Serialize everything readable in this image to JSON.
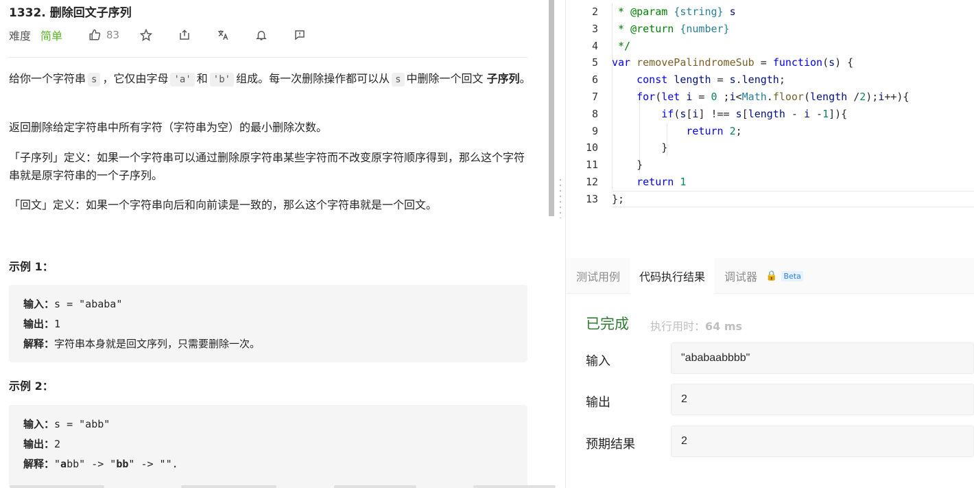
{
  "problem": {
    "title": "1332. 删除回文子序列",
    "difficulty_label": "难度",
    "difficulty": "简单",
    "like_count": "83",
    "desc1_pre": "给你一个字符串",
    "desc1_s": "s",
    "desc1_mid1": "，它仅由字母",
    "desc1_a": "'a'",
    "desc1_and": "和",
    "desc1_b": "'b'",
    "desc1_mid2": "组成。每一次删除操作都可以从",
    "desc1_s2": "s",
    "desc1_mid3": "中删除一个回文",
    "desc1_bold": "子序列",
    "desc1_end": "。",
    "desc2": "返回删除给定字符串中所有字符（字符串为空）的最小删除次数。",
    "desc3": "「子序列」定义：如果一个字符串可以通过删除原字符串某些字符而不改变原字符顺序得到，那么这个字符串就是原字符串的一个子序列。",
    "desc4": "「回文」定义：如果一个字符串向后和向前读是一致的，那么这个字符串就是一个回文。",
    "examples": [
      {
        "title": "示例 1：",
        "input_label": "输入：",
        "input": "s = \"ababa\"",
        "output_label": "输出：",
        "output": "1",
        "explain_label": "解释：",
        "explain": "字符串本身就是回文序列，只需要删除一次。"
      },
      {
        "title": "示例 2：",
        "input_label": "输入：",
        "input": "s = \"abb\"",
        "output_label": "输出：",
        "output": "2",
        "explain_label": "解释：",
        "explain_q1": "\"",
        "explain_a": "a",
        "explain_rest1": "bb\" -> \"",
        "explain_bb": "bb",
        "explain_rest2": "\" -> \"\"."
      }
    ]
  },
  "editor": {
    "line_numbers": [
      "2",
      "3",
      "4",
      "5",
      "6",
      "7",
      "8",
      "9",
      "10",
      "11",
      "12",
      "13"
    ]
  },
  "result_panel": {
    "tabs": [
      "测试用例",
      "代码执行结果",
      "调试器"
    ],
    "active_tab": "代码执行结果",
    "beta_label": "Beta",
    "status": "已完成",
    "time_label": "执行用时：",
    "time_value": "64 ms",
    "input_label": "输入",
    "input_value": "\"ababaabbbb\"",
    "output_label": "输出",
    "output_value": "2",
    "expected_label": "预期结果",
    "expected_value": "2"
  },
  "colors": {
    "easy_green": "#5ab726",
    "success_green": "#2f7d31",
    "keyword_blue": "#0000ff",
    "comment_green": "#008000"
  },
  "icons": [
    "thumbs-up-icon",
    "star-icon",
    "share-icon",
    "translate-icon",
    "bell-icon",
    "feedback-icon",
    "lock-icon"
  ]
}
